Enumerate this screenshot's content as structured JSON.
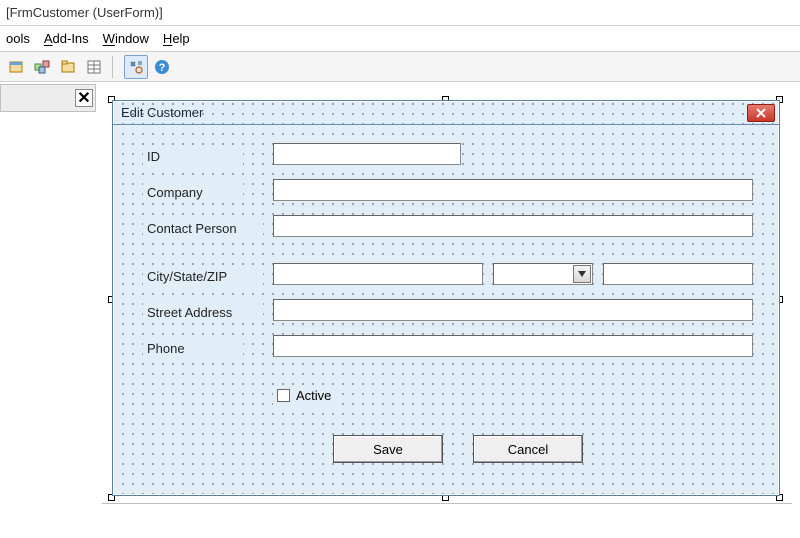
{
  "window": {
    "title": "[FrmCustomer (UserForm)]"
  },
  "menu": {
    "tools": "ools",
    "addins": "Add-Ins",
    "window": "Window",
    "help": "Help"
  },
  "userform": {
    "caption": "Edit Customer",
    "labels": {
      "id": "ID",
      "company": "Company",
      "contact": "Contact Person",
      "csz": "City/State/ZIP",
      "street": "Street Address",
      "phone": "Phone",
      "active": "Active"
    },
    "fields": {
      "id": "",
      "company": "",
      "contact": "",
      "city": "",
      "state_selected": "",
      "zip": "",
      "street": "",
      "phone": "",
      "active_checked": false
    },
    "buttons": {
      "save": "Save",
      "cancel": "Cancel"
    }
  }
}
